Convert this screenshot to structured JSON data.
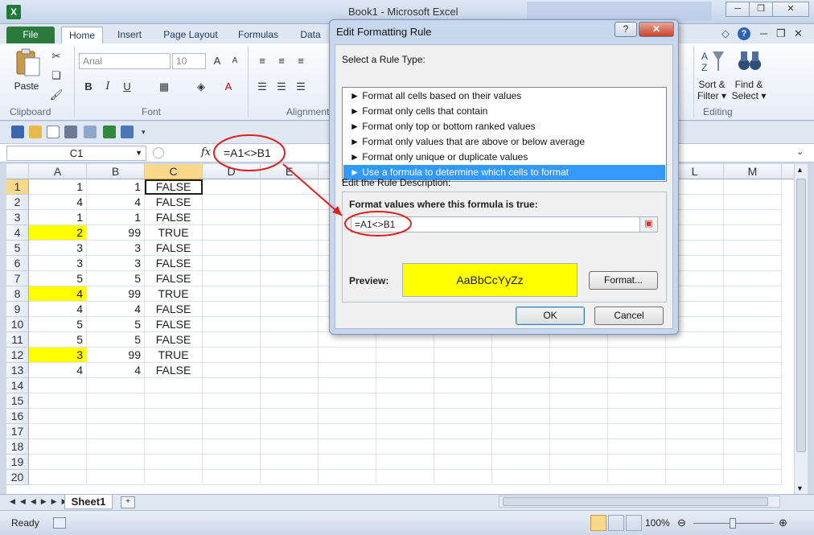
{
  "window": {
    "title": "Book1  -  Microsoft Excel",
    "app_icon": "X",
    "minimize_glyph": "─",
    "restore_glyph": "❐",
    "close_glyph": "✕"
  },
  "ribbon_tabs": [
    "File",
    "Home",
    "Insert",
    "Page Layout",
    "Formulas",
    "Data"
  ],
  "ribbon": {
    "clipboard": {
      "label": "Clipboard",
      "paste": "Paste"
    },
    "font": {
      "label": "Font",
      "font_name": "Arial",
      "font_size": "10"
    },
    "alignment": {
      "label": "Alignment"
    },
    "editing": {
      "label": "Editing",
      "sort_filter_line1": "Sort &",
      "sort_filter_line2": "Filter",
      "find_select_line1": "Find &",
      "find_select_line2": "Select"
    }
  },
  "formula_bar": {
    "name_box": "C1",
    "fx": "fx",
    "formula": "=A1<>B1"
  },
  "grid": {
    "columns": [
      "A",
      "B",
      "C",
      "D",
      "E",
      "L",
      "M"
    ],
    "row_numbers": [
      "1",
      "2",
      "3",
      "4",
      "5",
      "6",
      "7",
      "8",
      "9",
      "10",
      "11",
      "12",
      "13",
      "14",
      "15",
      "16",
      "17",
      "18",
      "19",
      "20"
    ],
    "rows": [
      {
        "a": "1",
        "b": "1",
        "c": "FALSE",
        "highlight": false
      },
      {
        "a": "4",
        "b": "4",
        "c": "FALSE",
        "highlight": false
      },
      {
        "a": "1",
        "b": "1",
        "c": "FALSE",
        "highlight": false
      },
      {
        "a": "2",
        "b": "99",
        "c": "TRUE",
        "highlight": true
      },
      {
        "a": "3",
        "b": "3",
        "c": "FALSE",
        "highlight": false
      },
      {
        "a": "3",
        "b": "3",
        "c": "FALSE",
        "highlight": false
      },
      {
        "a": "5",
        "b": "5",
        "c": "FALSE",
        "highlight": false
      },
      {
        "a": "4",
        "b": "99",
        "c": "TRUE",
        "highlight": true
      },
      {
        "a": "4",
        "b": "4",
        "c": "FALSE",
        "highlight": false
      },
      {
        "a": "5",
        "b": "5",
        "c": "FALSE",
        "highlight": false
      },
      {
        "a": "5",
        "b": "5",
        "c": "FALSE",
        "highlight": false
      },
      {
        "a": "3",
        "b": "99",
        "c": "TRUE",
        "highlight": true
      },
      {
        "a": "4",
        "b": "4",
        "c": "FALSE",
        "highlight": false
      }
    ],
    "highlight_color": "#ffff00"
  },
  "sheet_tabs": [
    "Sheet1"
  ],
  "status": {
    "ready": "Ready",
    "zoom": "100%"
  },
  "dialog": {
    "title": "Edit Formatting Rule",
    "help": "?",
    "close": "✕",
    "rule_type_label": "Select a Rule Type:",
    "rule_types": [
      "► Format all cells based on their values",
      "► Format only cells that contain",
      "► Format only top or bottom ranked values",
      "► Format only values that are above or below average",
      "► Format only unique or duplicate values",
      "► Use a formula to determine which cells to format"
    ],
    "selected_rule_index": 5,
    "description_label": "Edit the Rule Description:",
    "formula_label": "Format values where this formula is true:",
    "formula_value": "=A1<>B1",
    "preview_label": "Preview:",
    "preview_text": "AaBbCcYyZz",
    "preview_color": "#ffff00",
    "format_button": "Format...",
    "ok_button": "OK",
    "cancel_button": "Cancel"
  },
  "annotation_color": "#e02020"
}
